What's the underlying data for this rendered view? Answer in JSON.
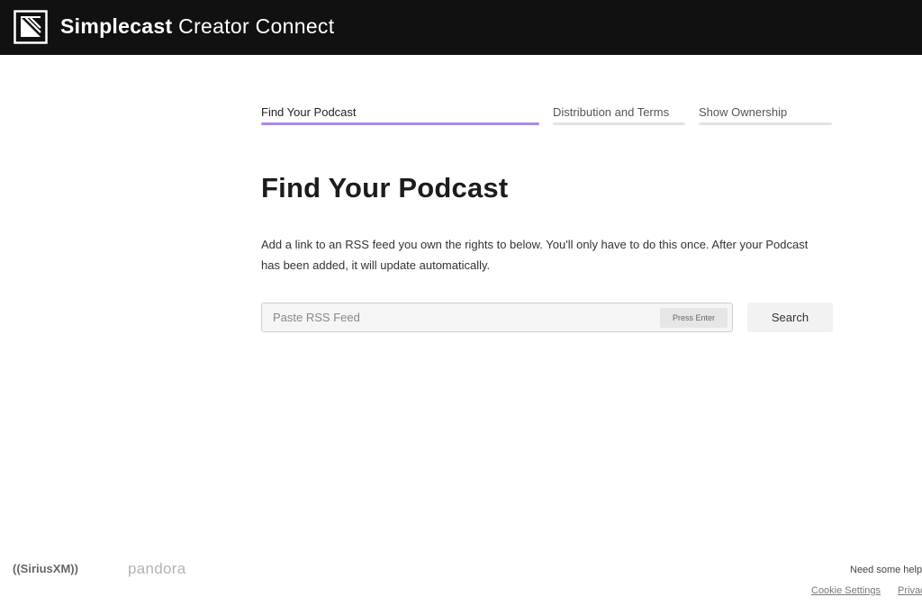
{
  "header": {
    "brand_bold": "Simplecast",
    "brand_light": "Creator Connect"
  },
  "steps": [
    {
      "label": "Find Your Podcast",
      "active": true
    },
    {
      "label": "Distribution and Terms",
      "active": false
    },
    {
      "label": "Show Ownership",
      "active": false
    }
  ],
  "main": {
    "title": "Find Your Podcast",
    "description": "Add a link to an RSS feed you own the rights to below. You'll only have to do this once. After your Podcast has been added, it will update automatically.",
    "rss_input": {
      "placeholder": "Paste RSS Feed",
      "value": ""
    },
    "press_enter_hint": "Press Enter",
    "search_button": "Search"
  },
  "footer": {
    "partner_siriusxm": "((SiriusXM))",
    "partner_pandora": "pandora",
    "help_text": "Need some help",
    "cookie_settings": "Cookie Settings",
    "privacy": "Privacy"
  },
  "colors": {
    "header_bg": "#111111",
    "accent": "#a98ae8"
  },
  "icons": [
    "simplecast-logo-icon"
  ]
}
